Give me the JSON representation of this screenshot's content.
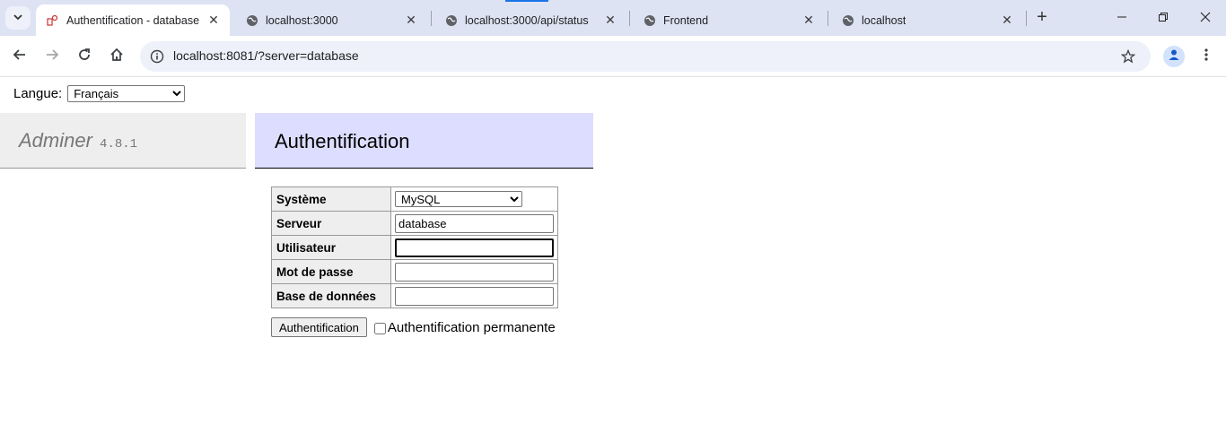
{
  "browser": {
    "tabs": [
      {
        "title": "Authentification - database",
        "active": true,
        "favicon": "adminer-icon"
      },
      {
        "title": "localhost:3000",
        "active": false,
        "favicon": "globe-icon"
      },
      {
        "title": "localhost:3000/api/status",
        "active": false,
        "favicon": "globe-icon"
      },
      {
        "title": "Frontend",
        "active": false,
        "favicon": "globe-icon"
      },
      {
        "title": "localhost",
        "active": false,
        "favicon": "globe-icon"
      }
    ],
    "url": "localhost:8081/?server=database",
    "accent": "#1a73e8"
  },
  "page": {
    "language_label": "Langue:",
    "language_value": "Français",
    "brand": "Adminer",
    "version": "4.8.1",
    "heading": "Authentification",
    "form": {
      "system_label": "Système",
      "system_value": "MySQL",
      "server_label": "Serveur",
      "server_value": "database",
      "user_label": "Utilisateur",
      "user_value": "",
      "password_label": "Mot de passe",
      "password_value": "",
      "database_label": "Base de données",
      "database_value": "",
      "submit_label": "Authentification",
      "permanent_label": "Authentification permanente"
    },
    "colors": {
      "header_bg": "#ddddff",
      "menu_bg": "#eeeeee"
    }
  }
}
